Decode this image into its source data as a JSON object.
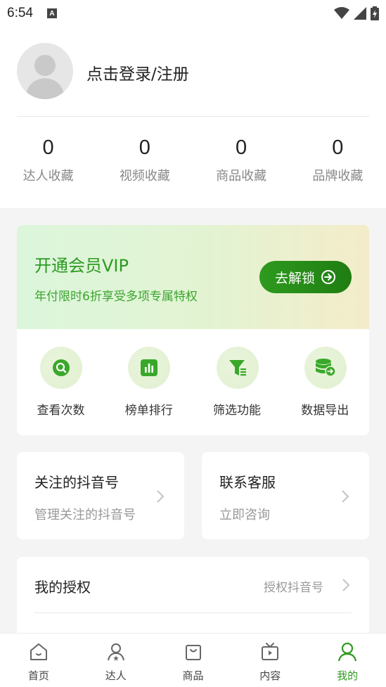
{
  "status_bar": {
    "time": "6:54",
    "indicator_letter": "A"
  },
  "profile": {
    "login_text": "点击登录/注册",
    "stats": [
      {
        "value": "0",
        "label": "达人收藏"
      },
      {
        "value": "0",
        "label": "视频收藏"
      },
      {
        "value": "0",
        "label": "商品收藏"
      },
      {
        "value": "0",
        "label": "品牌收藏"
      }
    ]
  },
  "vip": {
    "title": "开通会员VIP",
    "subtitle": "年付限时6折享受多项专属特权",
    "unlock_label": "去解锁",
    "features": [
      {
        "label": "查看次数",
        "icon": "search-icon"
      },
      {
        "label": "榜单排行",
        "icon": "bar-chart-icon"
      },
      {
        "label": "筛选功能",
        "icon": "filter-icon"
      },
      {
        "label": "数据导出",
        "icon": "database-export-icon"
      }
    ]
  },
  "cards": {
    "follow": {
      "title": "关注的抖音号",
      "subtitle": "管理关注的抖音号"
    },
    "service": {
      "title": "联系客服",
      "subtitle": "立即咨询"
    }
  },
  "auth": {
    "title": "我的授权",
    "action": "授权抖音号"
  },
  "tabs": [
    {
      "label": "首页",
      "icon": "home-icon"
    },
    {
      "label": "达人",
      "icon": "influencer-icon"
    },
    {
      "label": "商品",
      "icon": "shopping-bag-icon"
    },
    {
      "label": "内容",
      "icon": "tv-icon"
    },
    {
      "label": "我的",
      "icon": "user-icon",
      "active": true
    }
  ],
  "colors": {
    "accent": "#2e9a1e",
    "vip_text": "#2c9a21"
  }
}
